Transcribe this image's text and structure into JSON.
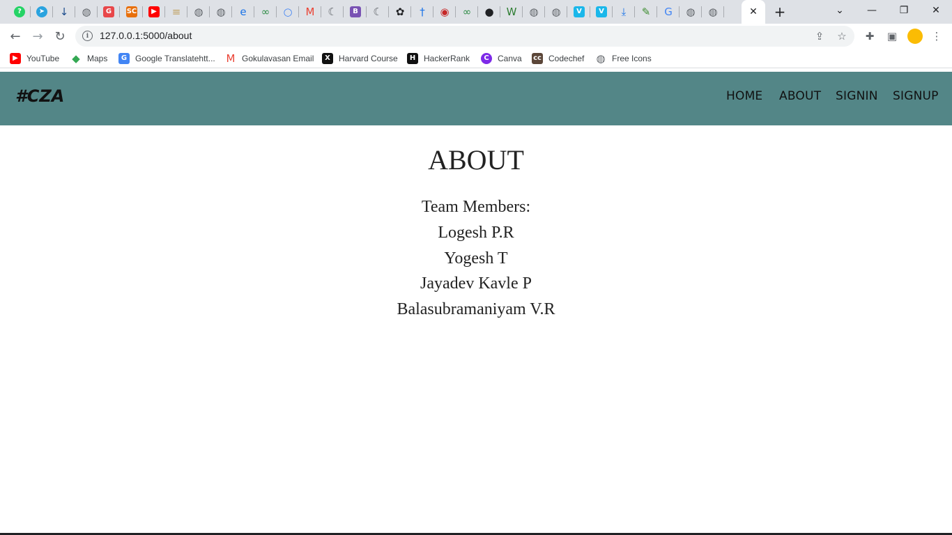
{
  "browser": {
    "tabs": [
      {
        "icon": "whatsapp-icon",
        "glyph": "?",
        "color": "#25d366"
      },
      {
        "icon": "telegram-icon",
        "glyph": "➤",
        "color": "#2aa3df"
      },
      {
        "icon": "pin-icon",
        "glyph": "↓",
        "color": "#1a4b8c"
      },
      {
        "icon": "globe-icon",
        "glyph": "◍",
        "color": "#5f6368"
      },
      {
        "icon": "grammarly-icon",
        "glyph": "G",
        "color": "#e8474a"
      },
      {
        "icon": "sc-icon",
        "glyph": "SC",
        "color": "#e8700c"
      },
      {
        "icon": "youtube-icon",
        "glyph": "▶",
        "color": "#ff0000"
      },
      {
        "icon": "document-icon",
        "glyph": "≡",
        "color": "#c0a060"
      },
      {
        "icon": "globe-icon",
        "glyph": "◍",
        "color": "#5f6368"
      },
      {
        "icon": "globe-icon",
        "glyph": "◍",
        "color": "#5f6368"
      },
      {
        "icon": "edge-icon",
        "glyph": "e",
        "color": "#1a73e8"
      },
      {
        "icon": "geeksforgeeks-icon",
        "glyph": "∞",
        "color": "#2f8d46"
      },
      {
        "icon": "circle-logo-icon",
        "glyph": "○",
        "color": "#4285f4"
      },
      {
        "icon": "gmail-icon",
        "glyph": "M",
        "color": "#ea4335"
      },
      {
        "icon": "moon-icon",
        "glyph": "☾",
        "color": "#5f6368"
      },
      {
        "icon": "bootstrap-icon",
        "glyph": "B",
        "color": "#7952b3"
      },
      {
        "icon": "moon-icon",
        "glyph": "☾",
        "color": "#5f6368"
      },
      {
        "icon": "openai-icon",
        "glyph": "✿",
        "color": "#202124"
      },
      {
        "icon": "cross-icon",
        "glyph": "†",
        "color": "#1a73e8"
      },
      {
        "icon": "badge-icon",
        "glyph": "◉",
        "color": "#c62828"
      },
      {
        "icon": "geeksforgeeks-icon",
        "glyph": "∞",
        "color": "#2f8d46"
      },
      {
        "icon": "github-icon",
        "glyph": "●",
        "color": "#202124"
      },
      {
        "icon": "w-logo-icon",
        "glyph": "W",
        "color": "#2e7d32"
      },
      {
        "icon": "globe-icon",
        "glyph": "◍",
        "color": "#5f6368"
      },
      {
        "icon": "globe-icon",
        "glyph": "◍",
        "color": "#5f6368"
      },
      {
        "icon": "vimeo-icon",
        "glyph": "V",
        "color": "#1ab7ea"
      },
      {
        "icon": "vimeo-icon",
        "glyph": "V",
        "color": "#1ab7ea"
      },
      {
        "icon": "download-icon",
        "glyph": "⤓",
        "color": "#1a73e8"
      },
      {
        "icon": "tool-icon",
        "glyph": "✎",
        "color": "#3c8d2f"
      },
      {
        "icon": "google-icon",
        "glyph": "G",
        "color": "#4285f4"
      },
      {
        "icon": "globe-icon",
        "glyph": "◍",
        "color": "#5f6368"
      },
      {
        "icon": "globe-icon",
        "glyph": "◍",
        "color": "#5f6368"
      }
    ],
    "active_tab_close": "✕",
    "new_tab": "+",
    "url": "127.0.0.1:5000/about",
    "bookmarks": [
      {
        "label": "YouTube",
        "icon": "youtube-icon",
        "glyph": "▶",
        "color": "#ff0000"
      },
      {
        "label": "Maps",
        "icon": "maps-pin-icon",
        "glyph": "◆",
        "color": "#34a853"
      },
      {
        "label": "Google Translatehtt...",
        "icon": "google-translate-icon",
        "glyph": "G",
        "color": "#4285f4"
      },
      {
        "label": "Gokulavasan Email",
        "icon": "gmail-icon",
        "glyph": "M",
        "color": "#ea4335"
      },
      {
        "label": "Harvard Course",
        "icon": "edx-icon",
        "glyph": "X",
        "color": "#111111"
      },
      {
        "label": "HackerRank",
        "icon": "hackerrank-icon",
        "glyph": "H",
        "color": "#111111"
      },
      {
        "label": "Canva",
        "icon": "canva-icon",
        "glyph": "C",
        "color": "#7d2ae8"
      },
      {
        "label": "Codechef",
        "icon": "codechef-icon",
        "glyph": "cc",
        "color": "#5b4638"
      },
      {
        "label": "Free Icons",
        "icon": "globe-icon",
        "glyph": "◍",
        "color": "#5f6368"
      }
    ]
  },
  "site": {
    "brand": "#CZA",
    "nav": [
      {
        "label": "HOME"
      },
      {
        "label": "ABOUT"
      },
      {
        "label": "SIGNIN"
      },
      {
        "label": "SIGNUP"
      }
    ],
    "nav_color": "#538687"
  },
  "about": {
    "title": "ABOUT",
    "heading": "Team Members:",
    "members": [
      "Logesh P.R",
      "Yogesh T",
      "Jayadev Kavle P",
      "Balasubramaniyam V.R"
    ]
  }
}
